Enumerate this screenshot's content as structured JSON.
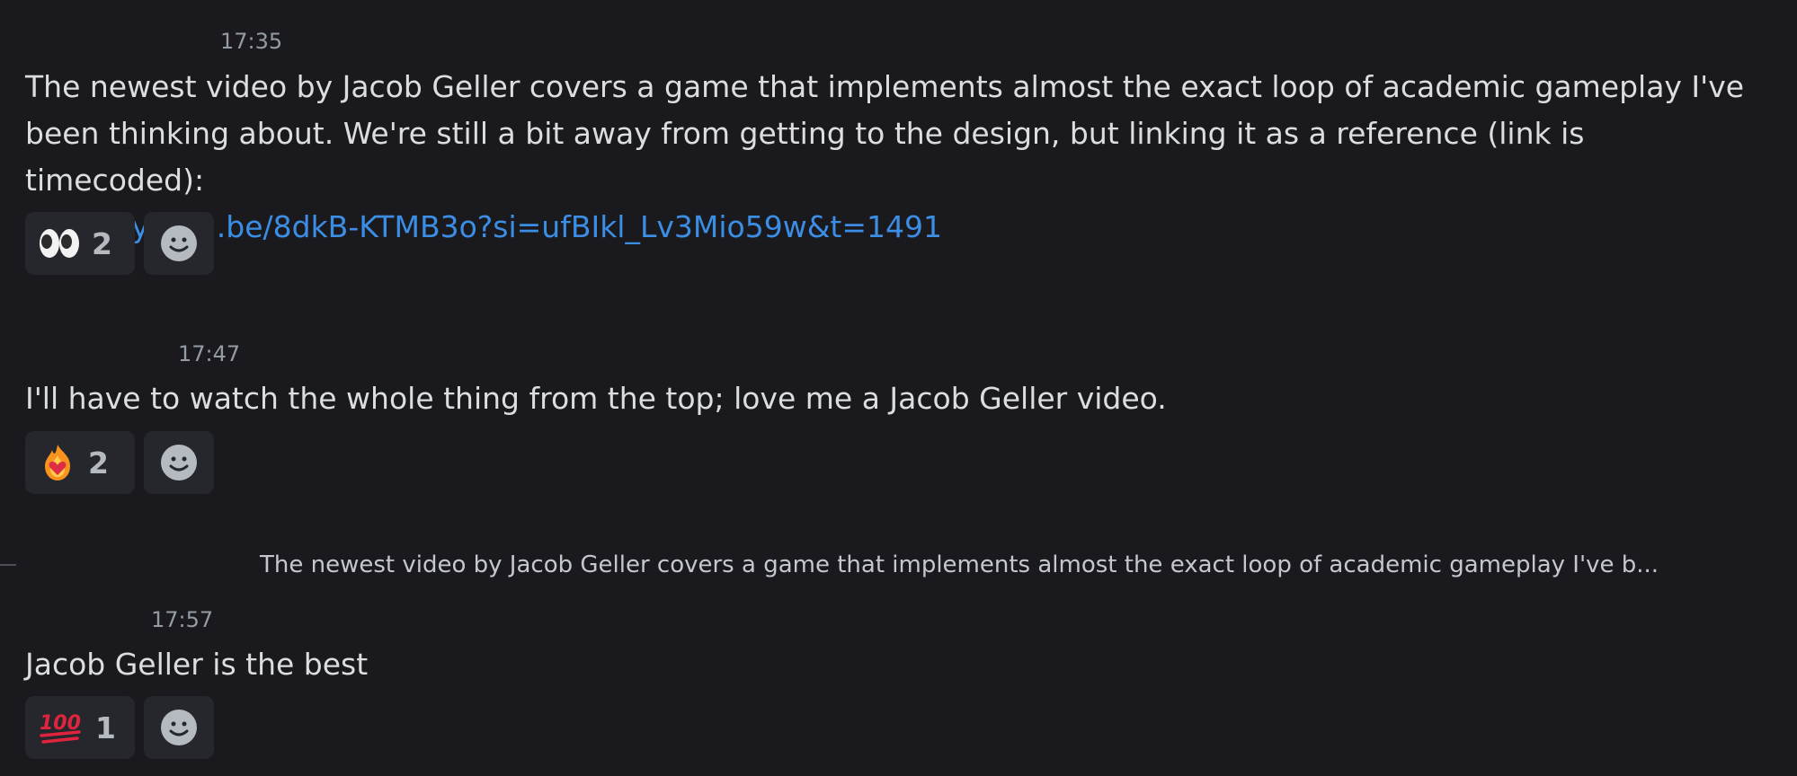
{
  "messages": [
    {
      "timestamp": "17:35",
      "text_line1": "The newest video by Jacob Geller covers a game that implements almost the exact loop of academic gameplay I've",
      "text_line2": "been thinking about. We're still a bit away from getting to the design, but linking it as a reference (link is timecoded):",
      "link": "https://youtu.be/8dkB-KTMB3o?si=ufBIkl_Lv3Mio59w&t=1491",
      "reaction": {
        "emoji": "eyes-emoji",
        "count": "2"
      }
    },
    {
      "timestamp": "17:47",
      "text": "I'll have to watch the whole thing from the top; love me a Jacob Geller video.",
      "reaction": {
        "emoji": "fire-heart-emoji",
        "count": "2"
      }
    },
    {
      "reply_preview": "The newest video by Jacob Geller covers a game that implements almost the exact loop of academic gameplay I've b...",
      "timestamp": "17:57",
      "text": "Jacob Geller is the best",
      "reaction": {
        "emoji": "hundred-points-emoji",
        "count": "1"
      }
    }
  ],
  "icons": {
    "add_reaction": "smile-add-reaction-icon"
  },
  "colors": {
    "background": "#1a1a1e",
    "reaction_bg": "#26272c",
    "link": "#3b8ee4",
    "text": "#dbdee1",
    "muted": "#949ba4"
  }
}
